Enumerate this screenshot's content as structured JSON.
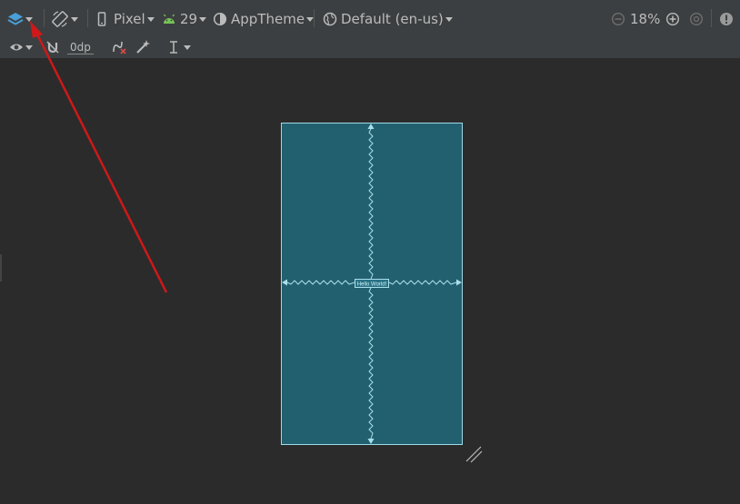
{
  "toolbar": {
    "device": "Pixel",
    "api_level": "29",
    "theme": "AppTheme",
    "locale": "Default (en-us)",
    "zoom": "18%"
  },
  "secondary_toolbar": {
    "default_margin": "0dp"
  },
  "blueprint": {
    "widget_text": "Hello World!"
  },
  "colors": {
    "toolbar_bg": "#3c3f41",
    "canvas_bg": "#2b2b2b",
    "blueprint_bg": "#22606f",
    "blueprint_line": "#9fd9e8",
    "annotation_arrow": "#d01818"
  }
}
